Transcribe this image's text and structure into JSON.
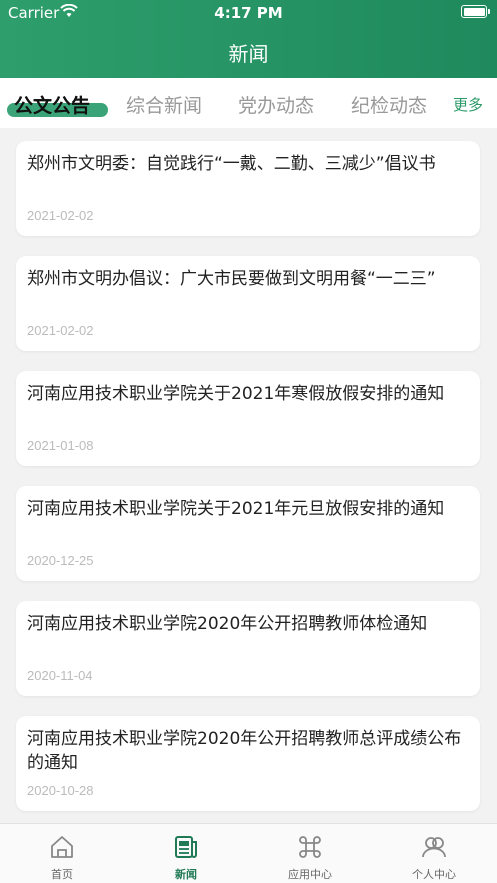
{
  "status_bar": {
    "carrier": "Carrier",
    "time": "4:17 PM"
  },
  "header": {
    "title": "新闻"
  },
  "tabs": [
    {
      "label": "公文公告",
      "active": true
    },
    {
      "label": "综合新闻",
      "active": false
    },
    {
      "label": "党办动态",
      "active": false
    },
    {
      "label": "纪检动态",
      "active": false
    }
  ],
  "tabs_more": "更多",
  "news": [
    {
      "title": "郑州市文明委：自觉践行“一戴、二勤、三减少”倡议书",
      "date": "2021-02-02"
    },
    {
      "title": "郑州市文明办倡议：广大市民要做到文明用餐“一二三”",
      "date": "2021-02-02"
    },
    {
      "title": "河南应用技术职业学院关于2021年寒假放假安排的通知",
      "date": "2021-01-08"
    },
    {
      "title": "河南应用技术职业学院关于2021年元旦放假安排的通知",
      "date": "2020-12-25"
    },
    {
      "title": "河南应用技术职业学院2020年公开招聘教师体检通知",
      "date": "2020-11-04"
    },
    {
      "title": "河南应用技术职业学院2020年公开招聘教师总评成绩公布的通知",
      "date": "2020-10-28"
    }
  ],
  "tabbar": [
    {
      "label": "首页",
      "icon": "home-icon"
    },
    {
      "label": "新闻",
      "icon": "news-icon",
      "active": true
    },
    {
      "label": "应用中心",
      "icon": "command-icon"
    },
    {
      "label": "个人中心",
      "icon": "profile-icon"
    }
  ],
  "colors": {
    "accent": "#2a9a68",
    "header_bg": "#1f8a5d",
    "page_bg": "#f2f2f2"
  }
}
